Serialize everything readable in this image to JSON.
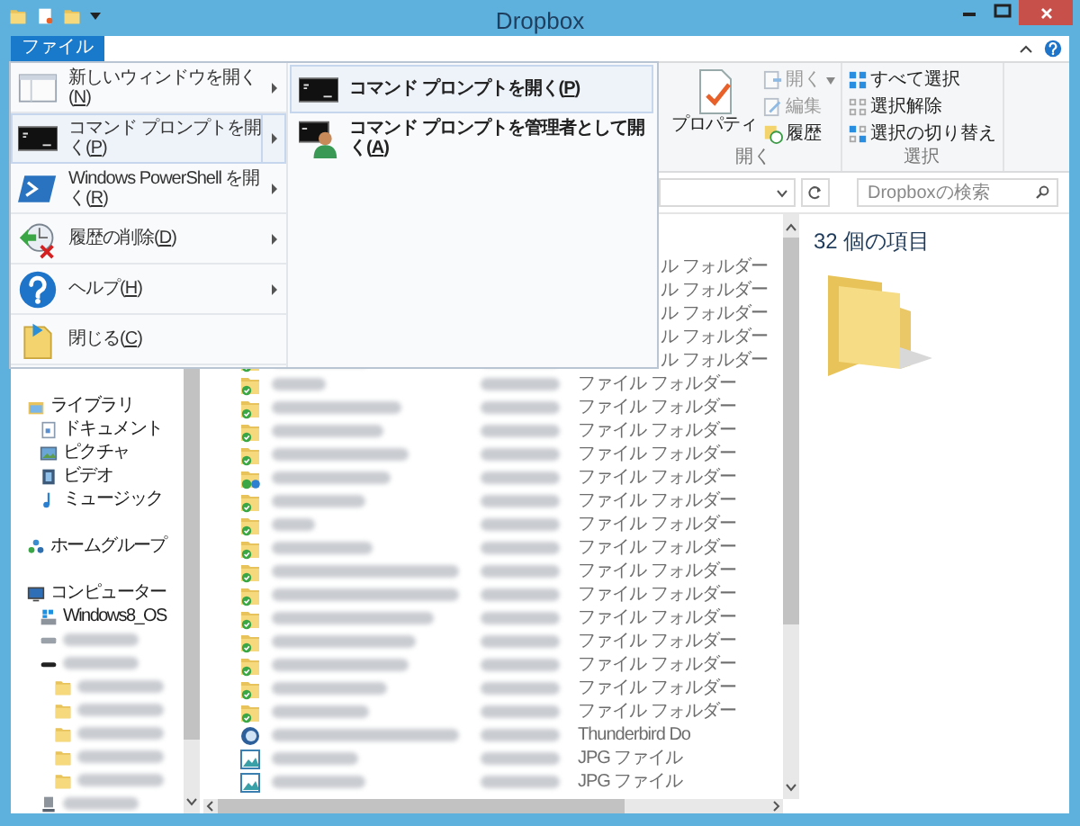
{
  "window": {
    "title": "Dropbox"
  },
  "ribbon": {
    "tabs": [
      {
        "label": "ファイル",
        "selected": true
      }
    ],
    "groups": [
      {
        "label": "開く",
        "big_button": "プロパティ",
        "items": [
          {
            "label": "開く",
            "kind": "open",
            "dropdown": true,
            "disabled": true
          },
          {
            "label": "編集",
            "kind": "edit",
            "dropdown": false,
            "disabled": true
          },
          {
            "label": "履歴",
            "kind": "history",
            "dropdown": false,
            "disabled": false
          }
        ]
      },
      {
        "label": "選択",
        "items": [
          {
            "label": "すべて選択",
            "kind": "select-all",
            "dropdown": false,
            "disabled": false
          },
          {
            "label": "選択解除",
            "kind": "select-none",
            "dropdown": false,
            "disabled": false
          },
          {
            "label": "選択の切り替え",
            "kind": "invert",
            "dropdown": false,
            "disabled": false
          }
        ]
      }
    ]
  },
  "address_bar": {
    "search_placeholder": "Dropboxの検索"
  },
  "navigation": {
    "items": [
      {
        "label": "ライブラリ",
        "kind": "library",
        "children": [
          {
            "label": "ドキュメント",
            "kind": "document"
          },
          {
            "label": "ピクチャ",
            "kind": "picture"
          },
          {
            "label": "ビデオ",
            "kind": "video"
          },
          {
            "label": "ミュージック",
            "kind": "music"
          }
        ]
      },
      {
        "label": "ホームグループ",
        "kind": "homegroup"
      },
      {
        "label": "コンピューター",
        "kind": "computer",
        "children": [
          {
            "label": "Windows8_OS",
            "kind": "os-drive"
          },
          {
            "redacted": true,
            "kind": "drive"
          },
          {
            "redacted": true,
            "kind": "optical-drive",
            "children": [
              {
                "redacted": true,
                "kind": "folder"
              },
              {
                "redacted": true,
                "kind": "folder"
              },
              {
                "redacted": true,
                "kind": "folder"
              },
              {
                "redacted": true,
                "kind": "folder"
              },
              {
                "redacted": true,
                "kind": "folder"
              }
            ]
          },
          {
            "redacted": true,
            "kind": "network-drive"
          }
        ]
      }
    ]
  },
  "file_list": {
    "rows": [
      {
        "kind": "synced-folder",
        "type": "ル フォルダー",
        "partial": true
      },
      {
        "kind": "synced-folder",
        "type": "ル フォルダー",
        "partial": true
      },
      {
        "kind": "synced-folder",
        "type": "ル フォルダー",
        "partial": true
      },
      {
        "kind": "synced-folder",
        "type": "ル フォルダー",
        "partial": true
      },
      {
        "kind": "synced-folder",
        "type": "ル フォルダー",
        "partial": true
      },
      {
        "kind": "synced-folder",
        "type": "ファイル フォルダー"
      },
      {
        "kind": "synced-folder",
        "type": "ファイル フォルダー"
      },
      {
        "kind": "synced-folder",
        "type": "ファイル フォルダー"
      },
      {
        "kind": "synced-folder",
        "type": "ファイル フォルダー"
      },
      {
        "kind": "shared-folder",
        "type": "ファイル フォルダー"
      },
      {
        "kind": "synced-folder",
        "type": "ファイル フォルダー"
      },
      {
        "kind": "synced-folder",
        "type": "ファイル フォルダー"
      },
      {
        "kind": "synced-folder",
        "type": "ファイル フォルダー"
      },
      {
        "kind": "synced-folder",
        "type": "ファイル フォルダー"
      },
      {
        "kind": "synced-folder",
        "type": "ファイル フォルダー"
      },
      {
        "kind": "synced-folder",
        "type": "ファイル フォルダー"
      },
      {
        "kind": "synced-folder",
        "type": "ファイル フォルダー"
      },
      {
        "kind": "synced-folder",
        "type": "ファイル フォルダー"
      },
      {
        "kind": "synced-folder",
        "type": "ファイル フォルダー"
      },
      {
        "kind": "synced-folder",
        "type": "ファイル フォルダー"
      },
      {
        "kind": "thunderbird",
        "type": "Thunderbird Do"
      },
      {
        "kind": "image",
        "type": "JPG ファイル"
      },
      {
        "kind": "image",
        "type": "JPG ファイル"
      }
    ]
  },
  "preview": {
    "item_count": "32 個の項目"
  },
  "file_menu": {
    "items": [
      {
        "label": "新しいウィンドウを開く(N)",
        "kind": "new-window",
        "submenu": true,
        "selected": false
      },
      {
        "label": "コマンド プロンプトを開く(P)",
        "kind": "console",
        "submenu": true,
        "selected": true
      },
      {
        "label": "Windows PowerShell を開く(R)",
        "kind": "powershell",
        "submenu": true,
        "selected": false
      },
      {
        "label": "履歴の削除(D)",
        "kind": "clear-history",
        "submenu": true,
        "selected": false
      },
      {
        "label": "ヘルプ(H)",
        "kind": "help",
        "submenu": true,
        "selected": false
      },
      {
        "label": "閉じる(C)",
        "kind": "close-folder",
        "submenu": false,
        "selected": false
      }
    ],
    "submenu": [
      {
        "label": "コマンド プロンプトを開く(P)",
        "kind": "console",
        "selected": true
      },
      {
        "label": "コマンド プロンプトを管理者として開く(A)",
        "kind": "admin-console",
        "selected": false
      }
    ]
  }
}
